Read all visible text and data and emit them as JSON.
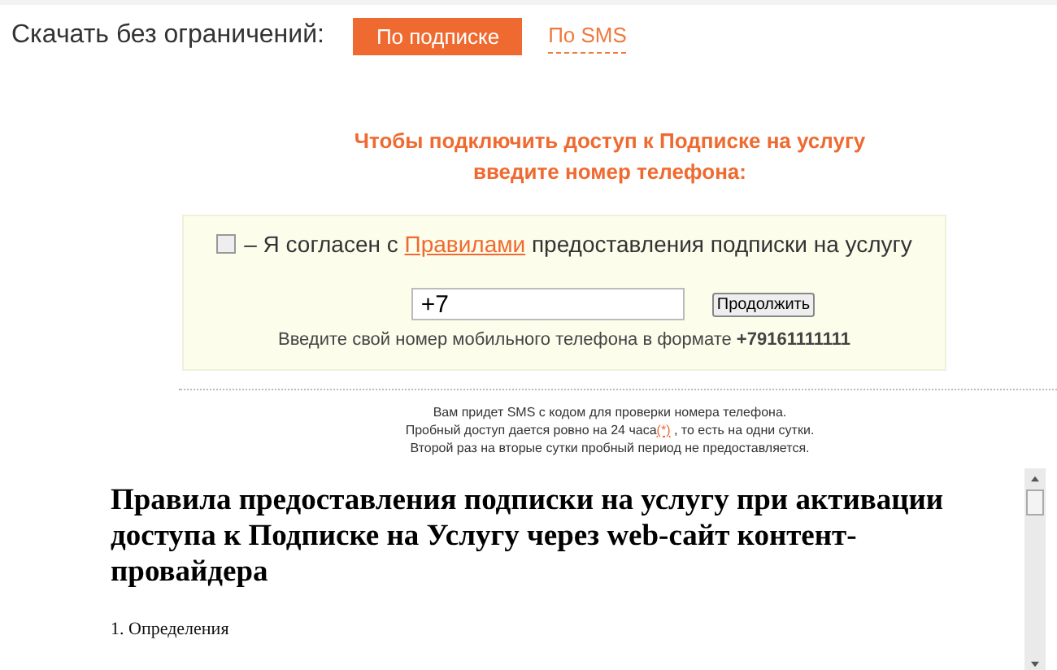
{
  "download": {
    "label": "Скачать без ограничений:",
    "tabs": [
      {
        "label": "По подписке",
        "selected": true
      },
      {
        "label": "По SMS",
        "selected": false
      }
    ]
  },
  "prompt": [
    "Чтобы подключить доступ к Подписке на услугу",
    "введите номер телефона:"
  ],
  "form": {
    "agree": {
      "checked": false,
      "before": "– Я согласен с",
      "link": "Правилами",
      "after": "предоставления подписки на услугу"
    },
    "phone": {
      "value": "+7"
    },
    "button": "Продолжить",
    "hint": "Введите свой номер мобильного телефона в формате **+79161111111**"
  },
  "notes": [
    {
      "text": "Вам придет SMS с кодом для проверки номера телефона."
    },
    {
      "text": "Пробный доступ дается ровно на 24 часа",
      "link": "(*)",
      "after": ", то есть на одни сутки."
    },
    {
      "text": "Второй раз на вторые сутки пробный период не предоставляется."
    }
  ],
  "rules": {
    "title": "Правила предоставления подписки на услугу при активации доступа к Подписке на Услугу через web-сайт контент-провайдера",
    "lines": [
      "1. Определения"
    ]
  }
}
